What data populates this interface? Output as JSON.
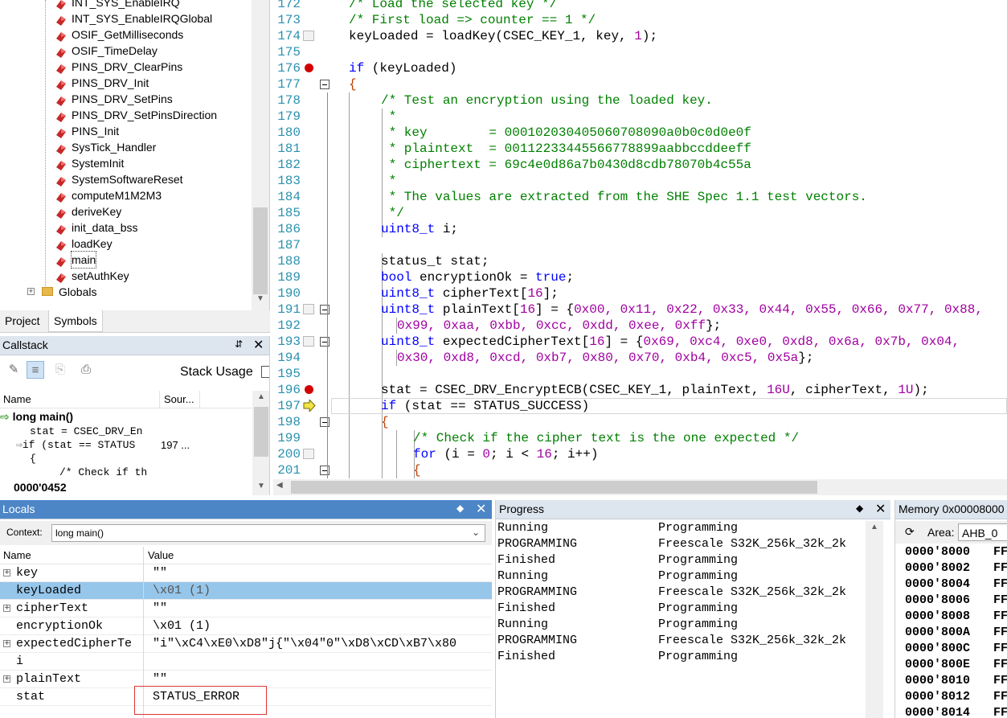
{
  "symbols": {
    "functions": [
      "INT_SYS_EnableIRQ",
      "INT_SYS_EnableIRQGlobal",
      "OSIF_GetMilliseconds",
      "OSIF_TimeDelay",
      "PINS_DRV_ClearPins",
      "PINS_DRV_Init",
      "PINS_DRV_SetPins",
      "PINS_DRV_SetPinsDirection",
      "PINS_Init",
      "SysTick_Handler",
      "SystemInit",
      "SystemSoftwareReset",
      "computeM1M2M3",
      "deriveKey",
      "init_data_bss",
      "loadKey",
      "main",
      "setAuthKey"
    ],
    "selected": "main",
    "globals_label": "Globals",
    "tabs": [
      "Project",
      "Symbols"
    ]
  },
  "callstack": {
    "title": "Callstack",
    "stack_usage_label": "Stack Usage",
    "col_name": "Name",
    "col_source": "Sour...",
    "frame_label": "long main()",
    "lines": [
      "stat = CSEC_DRV_En",
      "if (stat == STATUS",
      "{",
      "/* Check if th"
    ],
    "line_number": "197 ...",
    "address": "0000'0452"
  },
  "editor": {
    "line_numbers": [
      "172",
      "173",
      "174",
      "175",
      "176",
      "177",
      "178",
      "179",
      "180",
      "181",
      "182",
      "183",
      "184",
      "185",
      "186",
      "187",
      "188",
      "189",
      "190",
      "191",
      "192",
      "193",
      "194",
      "195",
      "196",
      "197",
      "198",
      "199",
      "200",
      "201"
    ],
    "lines": {
      "l172": "/* Load the selected key */",
      "l173": "/* First load => counter == 1 */",
      "l174_a": "keyLoaded = loadKey(CSEC_KEY_1, key, ",
      "l174_n": "1",
      "l174_b": ");",
      "l176_kw": "if",
      "l176_b": " (keyLoaded)",
      "l177": "{",
      "l178": "/* Test an encryption using the loaded key.",
      "l179": " *",
      "l180": " * key        = 000102030405060708090a0b0c0d0e0f",
      "l181": " * plaintext  = 00112233445566778899aabbccddeeff",
      "l182": " * ciphertext = 69c4e0d86a7b0430d8cdb78070b4c55a",
      "l183": " *",
      "l184": " * The values are extracted from the SHE Spec 1.1 test vectors.",
      "l185": " */",
      "l186_t": "uint8_t",
      "l186_b": " i;",
      "l188": "status_t stat;",
      "l189_t": "bool",
      "l189_b": " encryptionOk = ",
      "l189_k": "true",
      "l189_c": ";",
      "l190_t": "uint8_t",
      "l190_b": " cipherText[",
      "l190_n": "16",
      "l190_c": "];",
      "l191_t": "uint8_t",
      "l191_b": " plainText[",
      "l191_n": "16",
      "l191_c": "] = {",
      "l191_v": "0x00, 0x11, 0x22, 0x33, 0x44, 0x55, 0x66, 0x77, 0x88,",
      "l192_v": "0x99, 0xaa, 0xbb, 0xcc, 0xdd, 0xee, 0xff",
      "l192_c": "};",
      "l193_t": "uint8_t",
      "l193_b": " expectedCipherText[",
      "l193_n": "16",
      "l193_c": "] = {",
      "l193_v": "0x69, 0xc4, 0xe0, 0xd8, 0x6a, 0x7b, 0x04,",
      "l194_v": "0x30, 0xd8, 0xcd, 0xb7, 0x80, 0x70, 0xb4, 0xc5, 0x5a",
      "l194_c": "};",
      "l196_a": "stat = CSEC_DRV_EncryptECB(CSEC_KEY_1, plainText, ",
      "l196_n1": "16U",
      "l196_b": ", cipherText, ",
      "l196_n2": "1U",
      "l196_c": ");",
      "l197_kw": "if",
      "l197_b": " (stat == STATUS_SUCCESS)",
      "l198": "{",
      "l199": "/* Check if the cipher text is the one expected */",
      "l200_kw": "for",
      "l200_a": " (i = ",
      "l200_n1": "0",
      "l200_b": "; i < ",
      "l200_n2": "16",
      "l200_c": "; i++)",
      "l201": "{"
    }
  },
  "locals": {
    "title": "Locals",
    "context_label": "Context:",
    "context_value": "long main()",
    "col_name": "Name",
    "col_value": "Value",
    "rows": [
      {
        "name": "key",
        "value": "\"\""
      },
      {
        "name": "keyLoaded",
        "value": "\\x01 (1)"
      },
      {
        "name": "cipherText",
        "value": "\"\""
      },
      {
        "name": "encryptionOk",
        "value": "\\x01 (1)"
      },
      {
        "name": "expectedCipherTe",
        "value": "\"i\"\\xC4\\xE0\\xD8\"j{\"\\x04\"0\"\\xD8\\xCD\\xB7\\x80"
      },
      {
        "name": "i",
        "value": ""
      },
      {
        "name": "plainText",
        "value": "\"\""
      },
      {
        "name": "stat",
        "value": "STATUS_ERROR"
      }
    ]
  },
  "progress": {
    "title": "Progress",
    "rows": [
      {
        "status": "Running",
        "task": "Programming"
      },
      {
        "status": "PROGRAMMING",
        "task": "Freescale S32K_256k_32k_2k"
      },
      {
        "status": "Finished",
        "task": "Programming"
      },
      {
        "status": "Running",
        "task": "Programming"
      },
      {
        "status": "PROGRAMMING",
        "task": "Freescale S32K_256k_32k_2k"
      },
      {
        "status": "Finished",
        "task": "Programming"
      },
      {
        "status": "Running",
        "task": "Programming"
      },
      {
        "status": "PROGRAMMING",
        "task": "Freescale S32K_256k_32k_2k"
      },
      {
        "status": "Finished",
        "task": "Programming"
      }
    ]
  },
  "memory": {
    "title": "Memory 0x00008000",
    "area_label": "Area:",
    "area_value": "AHB_0",
    "rows": [
      {
        "addr": "0000'8000",
        "val": "FF"
      },
      {
        "addr": "0000'8002",
        "val": "FF"
      },
      {
        "addr": "0000'8004",
        "val": "FF"
      },
      {
        "addr": "0000'8006",
        "val": "FF"
      },
      {
        "addr": "0000'8008",
        "val": "FF"
      },
      {
        "addr": "0000'800A",
        "val": "FF"
      },
      {
        "addr": "0000'800C",
        "val": "FF"
      },
      {
        "addr": "0000'800E",
        "val": "FF"
      },
      {
        "addr": "0000'8010",
        "val": "FF"
      },
      {
        "addr": "0000'8012",
        "val": "FF"
      },
      {
        "addr": "0000'8014",
        "val": "FF"
      }
    ]
  },
  "colors": {
    "active_panel": "#4c86c7",
    "panel_header": "#dde5ee",
    "selection": "#96c6ea",
    "comment": "#008000",
    "keyword": "#0000ff",
    "number": "#a000a0",
    "breakpoint": "#d40000",
    "highlight_box": "#dd3333"
  }
}
